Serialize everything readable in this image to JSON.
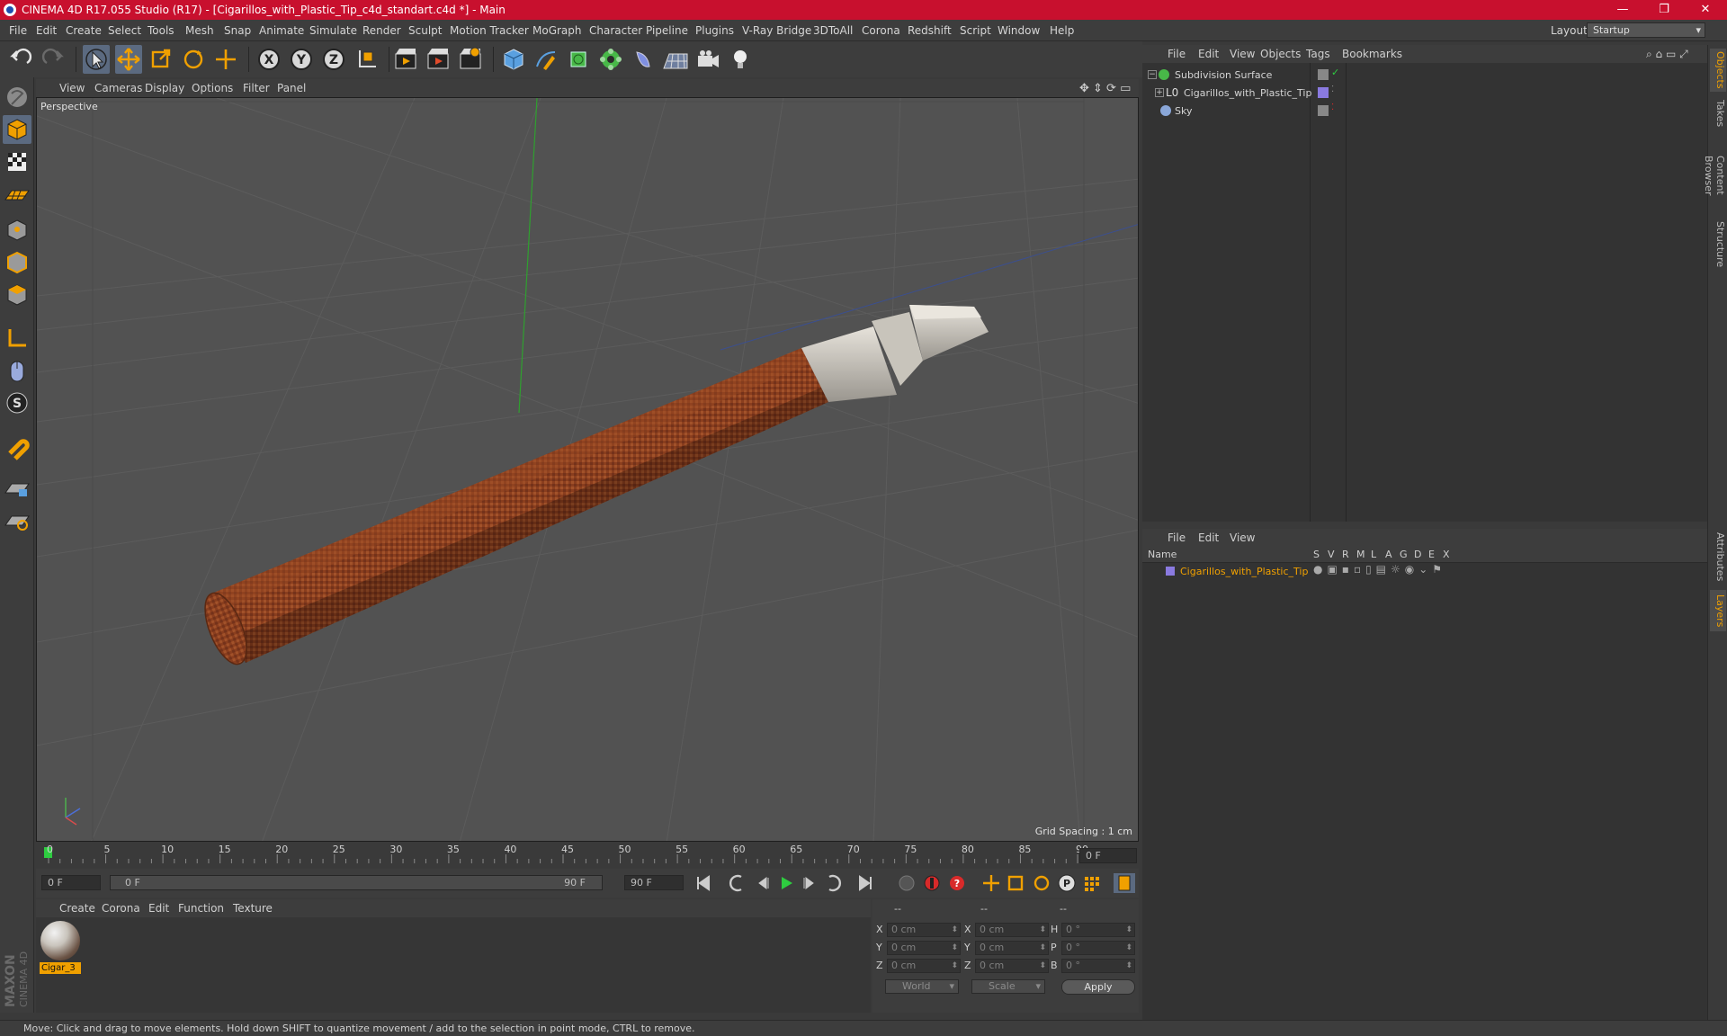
{
  "window": {
    "title": "CINEMA 4D R17.055 Studio (R17) - [Cigarillos_with_Plastic_Tip_c4d_standart.c4d *] - Main",
    "minimize": "—",
    "maximize": "❐",
    "close": "✕"
  },
  "menubar": {
    "items": [
      "File",
      "Edit",
      "Create",
      "Select",
      "Tools",
      "Mesh",
      "Snap",
      "Animate",
      "Simulate",
      "Render",
      "Sculpt",
      "Motion Tracker",
      "MoGraph",
      "Character",
      "Pipeline",
      "Plugins",
      "V-Ray Bridge",
      "3DToAll",
      "Corona",
      "Redshift",
      "Script",
      "Window",
      "Help"
    ],
    "layout_label": "Layout:",
    "layout_value": "Startup"
  },
  "toolbar": {
    "axis_x": "X",
    "axis_y": "Y",
    "axis_z": "Z"
  },
  "viewport": {
    "menu": [
      "View",
      "Cameras",
      "Display",
      "Options",
      "Filter",
      "Panel"
    ],
    "camera_label": "Perspective",
    "grid_spacing": "Grid Spacing : 1 cm"
  },
  "timeline": {
    "ticks": [
      "0",
      "5",
      "10",
      "15",
      "20",
      "25",
      "30",
      "35",
      "40",
      "45",
      "50",
      "55",
      "60",
      "65",
      "70",
      "75",
      "80",
      "85",
      "90"
    ],
    "current_frame": "0 F",
    "start_field": "0 F",
    "range_start": "0 F",
    "range_end": "90 F",
    "end_field": "90 F"
  },
  "material_manager": {
    "menu": [
      "Create",
      "Corona",
      "Edit",
      "Function",
      "Texture"
    ],
    "materials": [
      {
        "name": "Cigar_3"
      }
    ]
  },
  "coordinates": {
    "header": [
      "--",
      "--",
      "--"
    ],
    "rows": [
      {
        "a": "X",
        "av": "0 cm",
        "b": "X",
        "bv": "0 cm",
        "c": "H",
        "cv": "0 °"
      },
      {
        "a": "Y",
        "av": "0 cm",
        "b": "Y",
        "bv": "0 cm",
        "c": "P",
        "cv": "0 °"
      },
      {
        "a": "Z",
        "av": "0 cm",
        "b": "Z",
        "bv": "0 cm",
        "c": "B",
        "cv": "0 °"
      }
    ],
    "mode": "World",
    "transform": "Scale",
    "apply": "Apply"
  },
  "object_manager": {
    "menu": [
      "File",
      "Edit",
      "View",
      "Objects",
      "Tags",
      "Bookmarks"
    ],
    "objects": [
      {
        "name": "Subdivision Surface"
      },
      {
        "name": "Cigarillos_with_Plastic_Tip"
      },
      {
        "name": "Sky"
      }
    ]
  },
  "layer_manager": {
    "menu": [
      "File",
      "Edit",
      "View"
    ],
    "headers": [
      "Name",
      "S",
      "V",
      "R",
      "M",
      "L",
      "A",
      "G",
      "D",
      "E",
      "X"
    ],
    "layers": [
      {
        "name": "Cigarillos_with_Plastic_Tip"
      }
    ]
  },
  "side_tabs": [
    "Objects",
    "Takes",
    "Content Browser",
    "Structure",
    "Attributes",
    "Layers"
  ],
  "branding": "MAXON CINEMA 4D",
  "status": "Move: Click and drag to move elements. Hold down SHIFT to quantize movement / add to the selection in point mode, CTRL to remove.",
  "colors": {
    "title_bar": "#c8102e",
    "accent": "#f0a000",
    "panel": "#3d3d3d",
    "viewport": "#525252"
  }
}
